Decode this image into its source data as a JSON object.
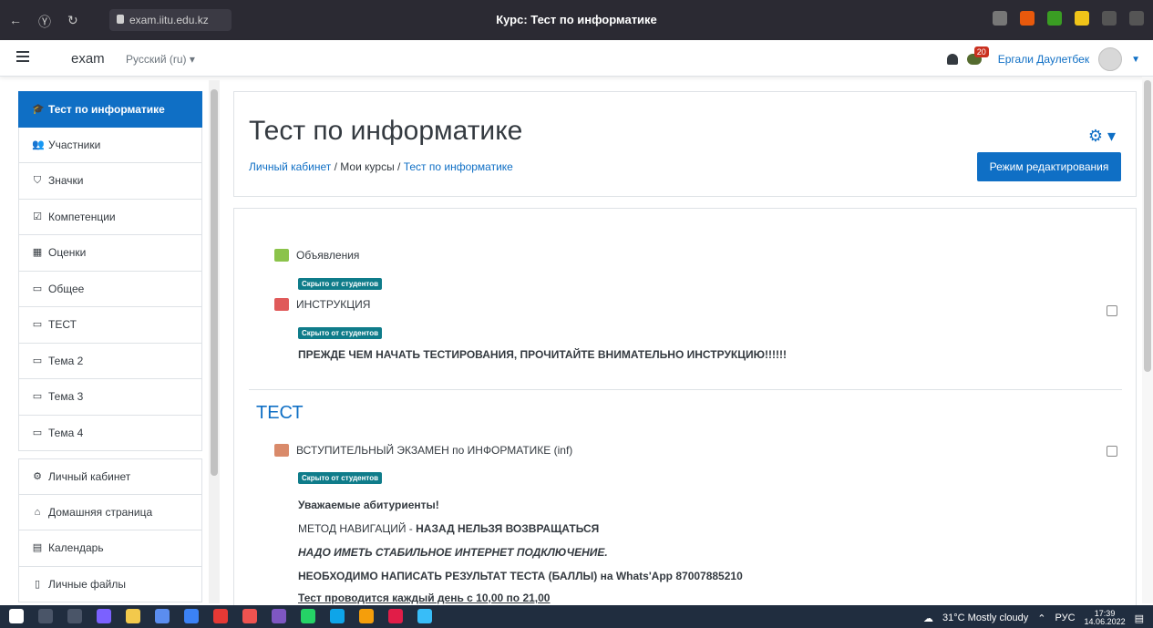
{
  "browser": {
    "url": "exam.iitu.edu.kz",
    "title": "Курс: Тест по информатике"
  },
  "navbar": {
    "brand": "exam",
    "language": "Русский (ru) ▾",
    "notification_count": "20",
    "user_name": "Ергали Даулетбек"
  },
  "sidebar": {
    "items": [
      {
        "label": "Тест по информатике",
        "icon": "graduation-cap-icon"
      },
      {
        "label": "Участники",
        "icon": "users-icon"
      },
      {
        "label": "Значки",
        "icon": "shield-icon"
      },
      {
        "label": "Компетенции",
        "icon": "check-square-icon"
      },
      {
        "label": "Оценки",
        "icon": "table-icon"
      },
      {
        "label": "Общее",
        "icon": "folder-icon"
      },
      {
        "label": "ТЕСТ",
        "icon": "folder-icon"
      },
      {
        "label": "Тема 2",
        "icon": "folder-icon"
      },
      {
        "label": "Тема 3",
        "icon": "folder-icon"
      },
      {
        "label": "Тема 4",
        "icon": "folder-icon"
      }
    ],
    "items2": [
      {
        "label": "Личный кабинет",
        "icon": "dashboard-icon"
      },
      {
        "label": "Домашняя страница",
        "icon": "home-icon"
      },
      {
        "label": "Календарь",
        "icon": "calendar-icon"
      },
      {
        "label": "Личные файлы",
        "icon": "file-icon"
      }
    ]
  },
  "header": {
    "title": "Тест по информатике",
    "breadcrumb": [
      "Личный кабинет",
      "Мои курсы",
      "Тест по информатике"
    ],
    "edit_button": "Режим редактирования"
  },
  "content": {
    "announcements": "Объявления",
    "hidden_label": "Скрыто от студентов",
    "instruction": "ИНСТРУКЦИЯ",
    "warning": "ПРЕЖДЕ ЧЕМ НАЧАТЬ ТЕСТИРОВАНИЯ, ПРОЧИТАЙТЕ ВНИМАТЕЛЬНО ИНСТРУКЦИЮ!!!!!!",
    "section_title": "ТЕСТ",
    "quiz": "ВСТУПИТЕЛЬНЫЙ ЭКЗАМЕН по ИНФОРМАТИКЕ (inf)",
    "lines": {
      "greeting": "Уважаемые абитуриенты!",
      "nav_prefix": "МЕТОД НАВИГАЦИЙ - ",
      "nav_bold": "НАЗАД НЕЛЬЗЯ ВОЗВРАЩАТЬСЯ",
      "internet": "НАДО ИМЕТЬ СТАБИЛЬНОЕ ИНТЕРНЕТ ПОДКЛЮЧЕНИЕ.",
      "whatsapp": "НЕОБХОДИМО НАПИСАТЬ РЕЗУЛЬТАТ ТЕСТА (БАЛЛЫ) на Whats'App 87007885210",
      "schedule": "Тест проводится каждый день с 10,00 по 21,00"
    }
  },
  "taskbar": {
    "weather": "31°C  Mostly cloudy",
    "lang": "РУС",
    "time": "17:39",
    "date": "14.06.2022"
  }
}
